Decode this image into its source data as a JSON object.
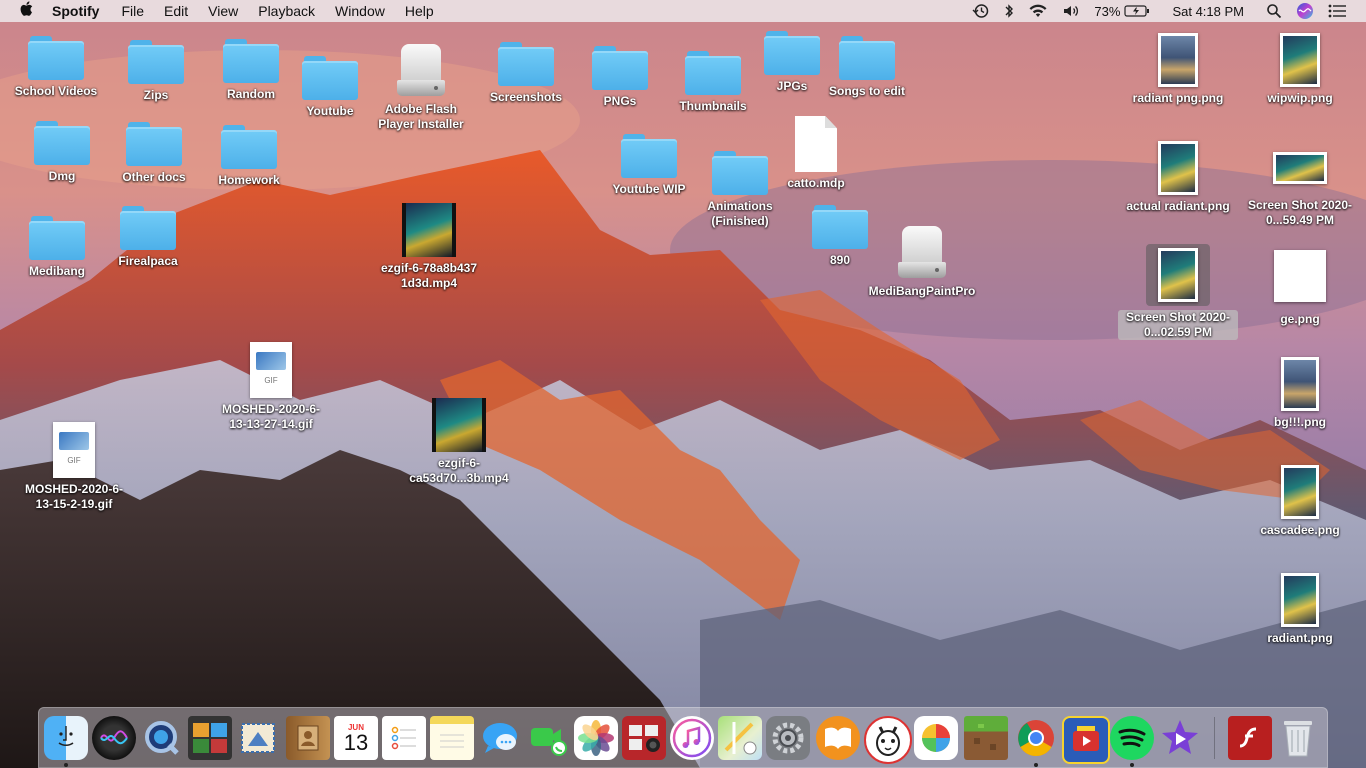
{
  "menubar": {
    "apple_icon": "apple-icon",
    "app_name": "Spotify",
    "menus": [
      "File",
      "Edit",
      "View",
      "Playback",
      "Window",
      "Help"
    ],
    "status_icons": [
      "time-machine-icon",
      "bluetooth-icon",
      "wifi-icon",
      "volume-icon"
    ],
    "battery": "73%",
    "clock": "Sat 4:18 PM",
    "right_icons": [
      "spotlight-icon",
      "siri-icon",
      "notification-center-icon"
    ]
  },
  "desktop": {
    "icons": [
      {
        "label": "School Videos",
        "kind": "folder"
      },
      {
        "label": "Zips",
        "kind": "folder"
      },
      {
        "label": "Random",
        "kind": "folder"
      },
      {
        "label": "Youtube",
        "kind": "folder"
      },
      {
        "label": "Adobe Flash Player Installer",
        "kind": "disk"
      },
      {
        "label": "Screenshots",
        "kind": "folder"
      },
      {
        "label": "PNGs",
        "kind": "folder"
      },
      {
        "label": "Thumbnails",
        "kind": "folder"
      },
      {
        "label": "JPGs",
        "kind": "folder"
      },
      {
        "label": "Songs to edit",
        "kind": "folder"
      },
      {
        "label": "Dmg",
        "kind": "folder"
      },
      {
        "label": "Other docs",
        "kind": "folder"
      },
      {
        "label": "Homework",
        "kind": "folder"
      },
      {
        "label": "Youtube WIP",
        "kind": "folder"
      },
      {
        "label": "Animations (Finished)",
        "kind": "folder"
      },
      {
        "label": "catto.mdp",
        "kind": "document"
      },
      {
        "label": "Medibang",
        "kind": "folder"
      },
      {
        "label": "Firealpaca",
        "kind": "folder"
      },
      {
        "label": "ezgif-6-78a8b437 1d3d.mp4",
        "kind": "video"
      },
      {
        "label": "890",
        "kind": "folder"
      },
      {
        "label": "MediBangPaintPro",
        "kind": "disk"
      },
      {
        "label": "MOSHED-2020-6-13-13-27-14.gif",
        "kind": "gif"
      },
      {
        "label": "ezgif-6-ca53d70...3b.mp4",
        "kind": "video"
      },
      {
        "label": "MOSHED-2020-6-13-15-2-19.gif",
        "kind": "gif"
      },
      {
        "label": "radiant png.png",
        "kind": "image"
      },
      {
        "label": "wipwip.png",
        "kind": "image"
      },
      {
        "label": "actual radiant.png",
        "kind": "image"
      },
      {
        "label": "Screen Shot 2020-0...59.49 PM",
        "kind": "image"
      },
      {
        "label": "Screen Shot 2020-0...02.59 PM",
        "kind": "image",
        "selected": true
      },
      {
        "label": "ge.png",
        "kind": "image"
      },
      {
        "label": "bg!!!.png",
        "kind": "image"
      },
      {
        "label": "cascadee.png",
        "kind": "image"
      },
      {
        "label": "radiant.png",
        "kind": "image"
      }
    ],
    "gif_tag": "GIF"
  },
  "dock": {
    "apps": [
      "finder-icon",
      "siri-icon",
      "quicktime-icon",
      "photo-booth-icon",
      "mail-icon",
      "contacts-icon",
      "calendar-icon",
      "reminders-icon",
      "notes-icon",
      "messages-icon",
      "facetime-icon",
      "photos-icon",
      "photo-booth-strip-icon",
      "itunes-icon",
      "maps-icon",
      "system-preferences-icon",
      "ibooks-icon",
      "alpaca-icon",
      "medibang-icon",
      "minecraft-icon",
      "chrome-icon",
      "pokemon-tv-icon",
      "spotify-icon",
      "imovie-icon",
      "flash-icon",
      "trash-icon"
    ],
    "calendar_month": "JUN",
    "calendar_day": "13"
  }
}
